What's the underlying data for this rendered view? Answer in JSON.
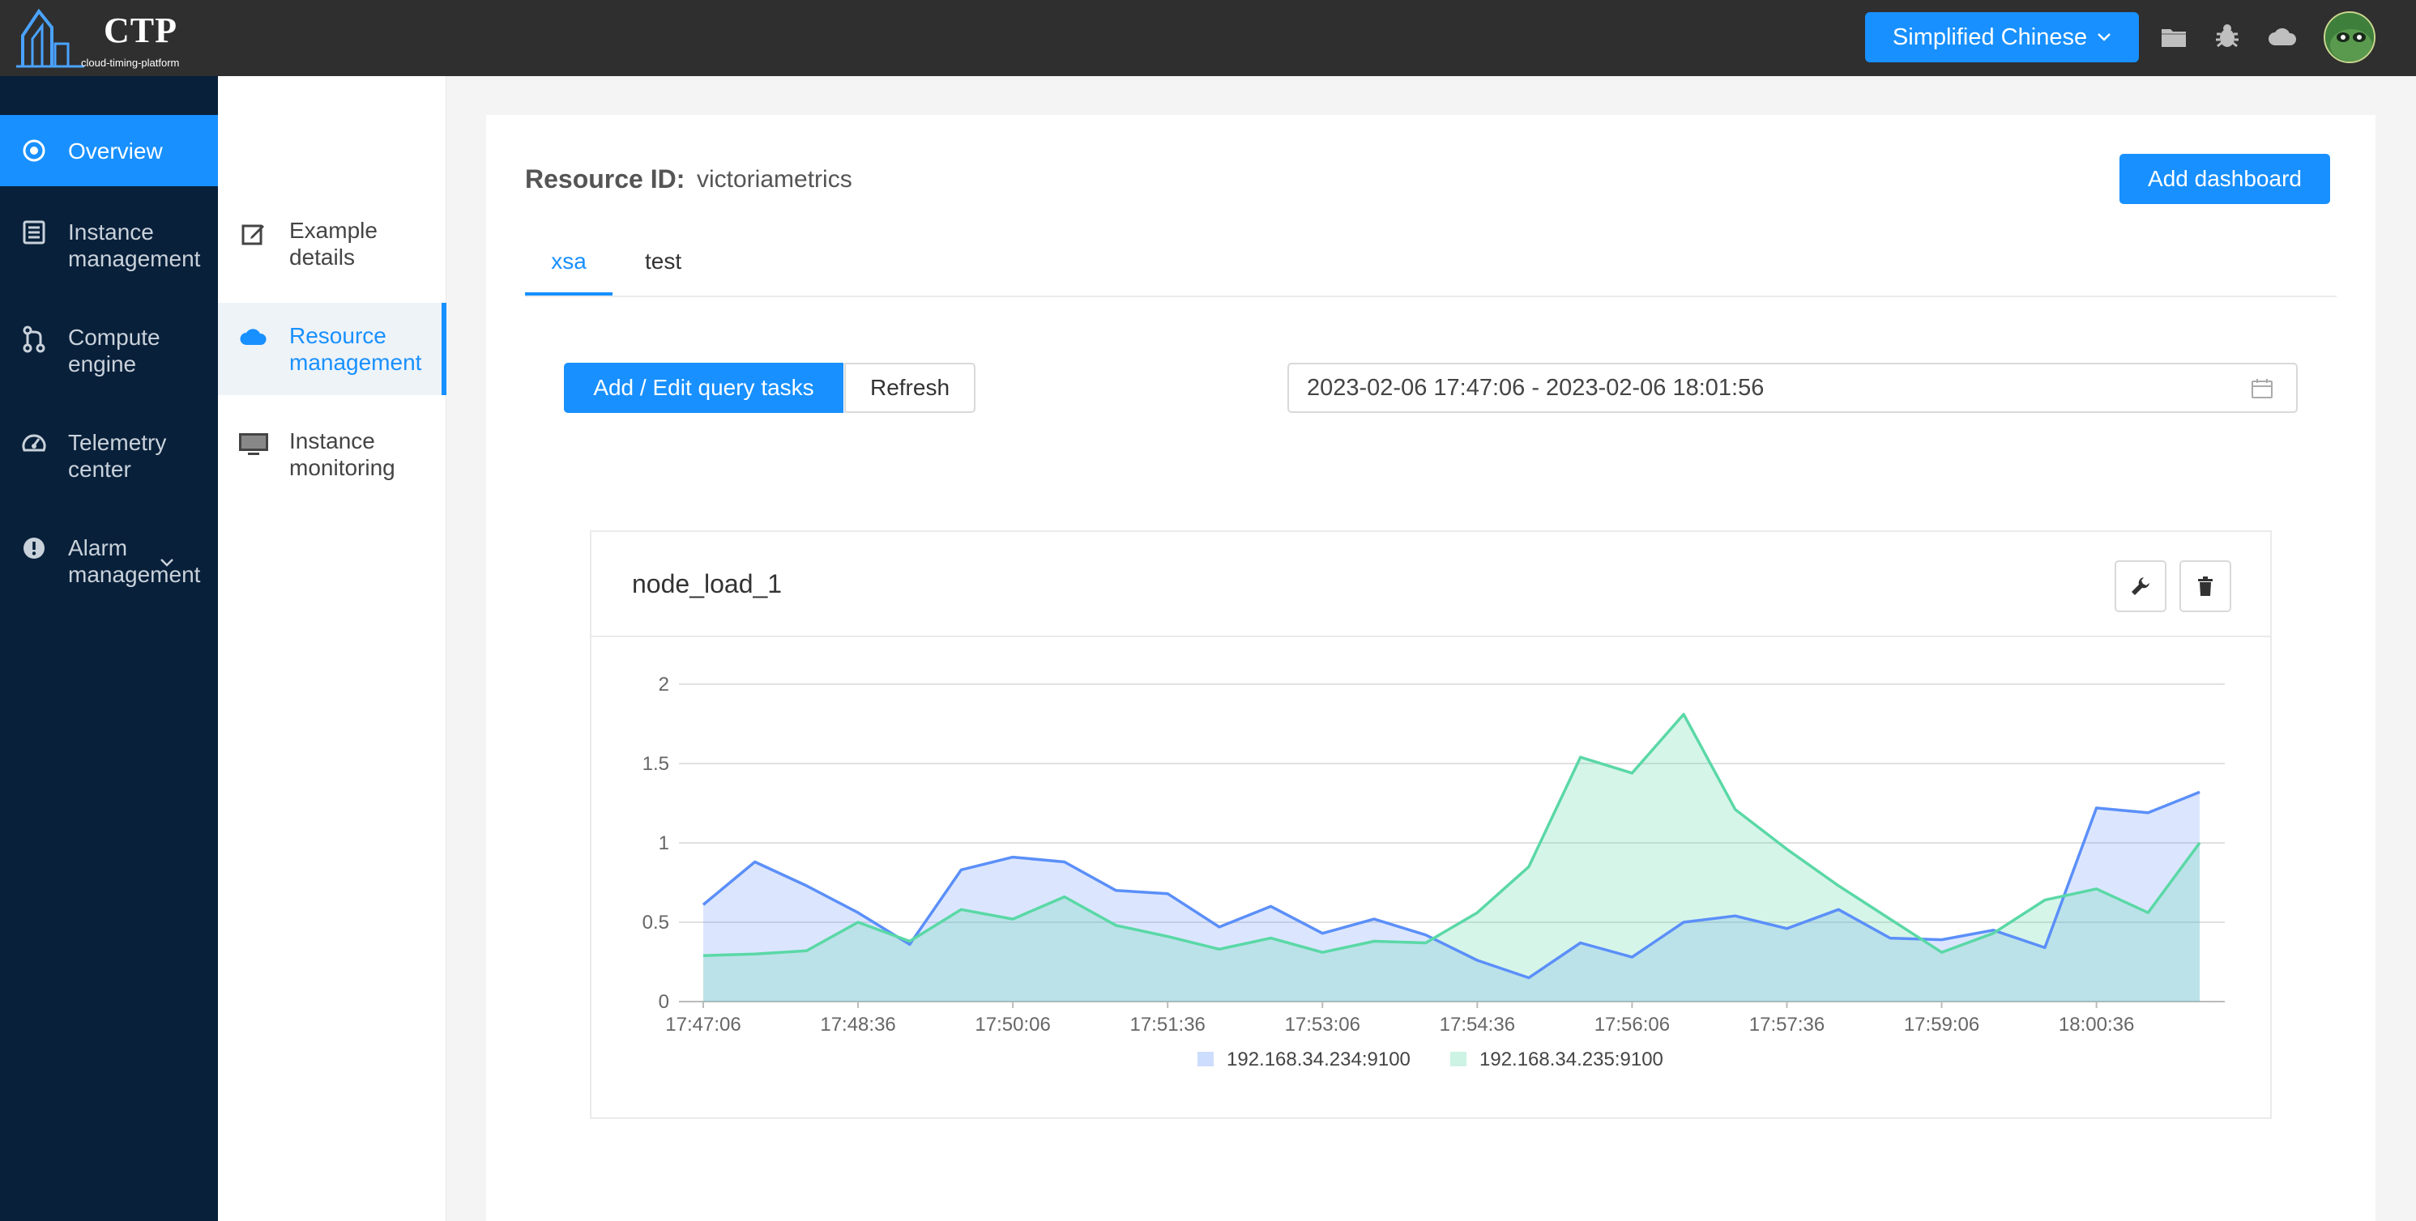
{
  "header": {
    "logo_title": "CTP",
    "logo_subtitle": "cloud-timing-platform",
    "language_label": "Simplified Chinese",
    "icons": [
      "folder-icon",
      "bug-icon",
      "cloud-icon"
    ]
  },
  "sidebar": {
    "items": [
      {
        "label": "Overview",
        "icon": "target-icon",
        "active": true
      },
      {
        "label": "Instance management",
        "icon": "list-icon"
      },
      {
        "label": "Compute engine",
        "icon": "branch-icon"
      },
      {
        "label": "Telemetry center",
        "icon": "dashboard-icon"
      },
      {
        "label": "Alarm management",
        "icon": "alert-icon"
      }
    ]
  },
  "subnav": {
    "items": [
      {
        "label": "Example details",
        "icon": "edit-icon"
      },
      {
        "label": "Resource management",
        "icon": "cloud-icon",
        "active": true
      },
      {
        "label": "Instance monitoring",
        "icon": "monitor-icon"
      }
    ]
  },
  "main": {
    "resource_label": "Resource ID:",
    "resource_value": "victoriametrics",
    "add_dashboard_label": "Add dashboard",
    "tabs": [
      {
        "label": "xsa",
        "active": true
      },
      {
        "label": "test"
      }
    ],
    "add_edit_label": "Add / Edit query tasks",
    "refresh_label": "Refresh",
    "date_range": "2023-02-06 17:47:06 - 2023-02-06 18:01:56"
  },
  "panel": {
    "title": "node_load_1",
    "icons": [
      "wrench-icon",
      "trash-icon"
    ]
  },
  "colors": {
    "accent": "#1890ff",
    "series1": "#5b8ff9",
    "series2": "#5ad8a6"
  },
  "chart_data": {
    "type": "area",
    "title": "node_load_1",
    "x": [
      "17:47:06",
      "17:47:36",
      "17:48:06",
      "17:48:36",
      "17:49:06",
      "17:49:36",
      "17:50:06",
      "17:50:36",
      "17:51:06",
      "17:51:36",
      "17:52:06",
      "17:52:36",
      "17:53:06",
      "17:53:36",
      "17:54:06",
      "17:54:36",
      "17:55:06",
      "17:55:36",
      "17:56:06",
      "17:56:36",
      "17:57:06",
      "17:57:36",
      "17:58:06",
      "17:58:36",
      "17:59:06",
      "17:59:36",
      "18:00:06",
      "18:00:36",
      "18:01:06",
      "18:01:36"
    ],
    "x_tick_labels": [
      "17:47:06",
      "17:48:36",
      "17:50:06",
      "17:51:36",
      "17:53:06",
      "17:54:36",
      "17:56:06",
      "17:57:36",
      "17:59:06",
      "18:00:36"
    ],
    "y_ticks": [
      0,
      0.5,
      1,
      1.5,
      2
    ],
    "ylim": [
      0,
      2
    ],
    "grid": true,
    "legend_position": "bottom",
    "series": [
      {
        "name": "192.168.34.234:9100",
        "color": "#5b8ff9",
        "values": [
          0.61,
          0.88,
          0.73,
          0.56,
          0.36,
          0.83,
          0.91,
          0.88,
          0.7,
          0.68,
          0.47,
          0.6,
          0.43,
          0.52,
          0.42,
          0.26,
          0.15,
          0.37,
          0.28,
          0.5,
          0.54,
          0.46,
          0.58,
          0.4,
          0.39,
          0.45,
          0.34,
          1.22,
          1.19,
          1.32
        ]
      },
      {
        "name": "192.168.34.235:9100",
        "color": "#5ad8a6",
        "values": [
          0.29,
          0.3,
          0.32,
          0.5,
          0.38,
          0.58,
          0.52,
          0.66,
          0.48,
          0.41,
          0.33,
          0.4,
          0.31,
          0.38,
          0.37,
          0.56,
          0.85,
          1.54,
          1.44,
          1.81,
          1.21,
          0.96,
          0.73,
          0.52,
          0.31,
          0.43,
          0.64,
          0.71,
          0.56,
          1.0
        ]
      }
    ]
  }
}
